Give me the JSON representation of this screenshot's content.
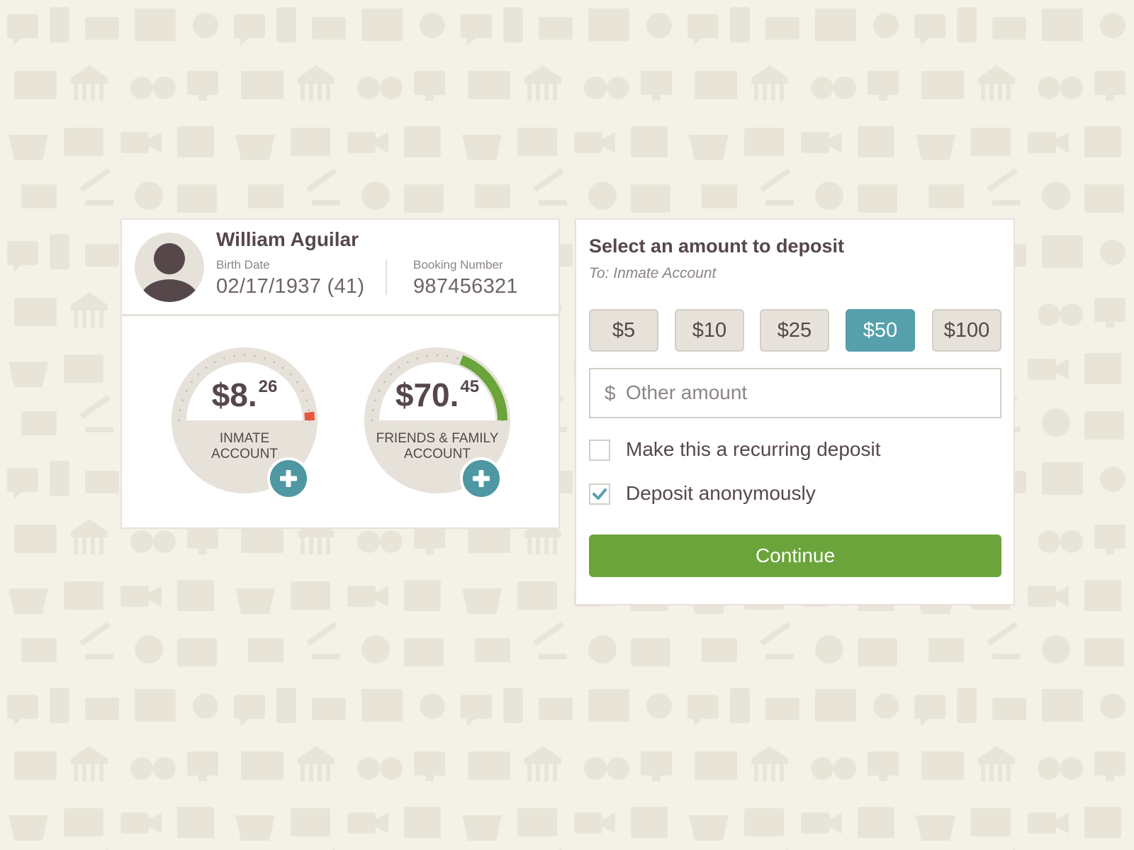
{
  "inmate": {
    "name": "William Aguilar",
    "birth_label": "Birth Date",
    "birth_value": "02/17/1937 (41)",
    "booking_label": "Booking Number",
    "booking_value": "987456321"
  },
  "accounts": [
    {
      "dollars": "$8.",
      "cents": "26",
      "label_line1": "INMATE",
      "label_line2": "ACCOUNT",
      "fill_fraction": 0.04,
      "fill_color": "#e8573c",
      "add_icon": "plus-icon"
    },
    {
      "dollars": "$70.",
      "cents": "45",
      "label_line1": "FRIENDS & FAMILY",
      "label_line2": "ACCOUNT",
      "fill_fraction": 0.38,
      "fill_color": "#6aa43a",
      "add_icon": "plus-icon"
    }
  ],
  "deposit": {
    "title": "Select an amount to deposit",
    "subtitle": "To: Inmate Account",
    "amounts": [
      "$5",
      "$10",
      "$25",
      "$50",
      "$100"
    ],
    "selected_amount": "$50",
    "other_currency": "$",
    "other_placeholder": "Other amount",
    "recurring_label": "Make this a recurring deposit",
    "recurring_checked": false,
    "anonymous_label": "Deposit anonymously",
    "anonymous_checked": true,
    "continue_label": "Continue"
  },
  "colors": {
    "background": "#f4f2e8",
    "pattern": "#e8e5d8",
    "accent_teal": "#56a0ac",
    "accent_green": "#6aa43a",
    "alert_red": "#e8573c",
    "text": "#55474a"
  }
}
